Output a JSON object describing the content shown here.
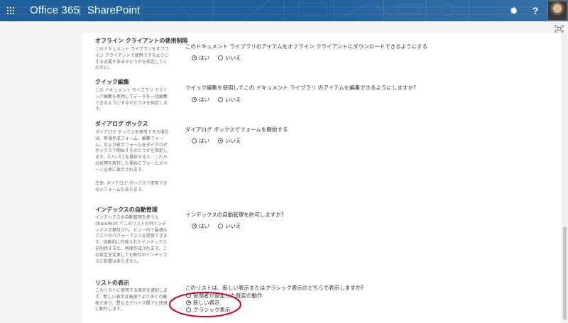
{
  "suite": {
    "brand": "Office 365",
    "app": "SharePoint",
    "icons": {
      "waffle": "app-launcher-icon",
      "settings": "gear-icon",
      "help": "help-icon",
      "avatar": "user-avatar"
    },
    "help_glyph": "?",
    "colors": {
      "suite_bar": "#1e5f9c",
      "panel": "#ffffff",
      "background": "#f4f4f4",
      "annotation": "#d0021b"
    }
  },
  "sections": [
    {
      "title": "オフライン クライアントの使用制限",
      "description": "このドキュメント ライブラリをオフライン クライアントで使用できるようにする必要があるかどうかを指定してください。",
      "question": "このドキュメント ライブラリのアイテムをオフライン クライアントにダウンロードできるようにする",
      "options": [
        {
          "label": "はい",
          "selected": true
        },
        {
          "label": "いいえ",
          "selected": false
        }
      ]
    },
    {
      "title": "クイック編集",
      "description": "この ドキュメント ライブラリ でクイック編集を使用してデータを一括編集できるようにするかどうかを指定します。",
      "question": "クイック編集を使用してこの ドキュメント ライブラリ のアイテムを編集できるようにしますか?",
      "options": [
        {
          "label": "はい",
          "selected": true
        },
        {
          "label": "いいえ",
          "selected": false
        }
      ]
    },
    {
      "title": "ダイアログ ボックス",
      "description": "ダイアログ ボックスを使用できる場合は、新規作成フォーム、編集フォーム、および表示フォームをダイアログ ボックスで開始するかどうかを指定します。[いいえ] を選択すると、これらの処理を実行した場合にフォームがページ全体に表示されます。",
      "note": "注意: ダイアログ ボックスで使用できないフォームもあります。",
      "question": "ダイアログ ボックスでフォームを開始する",
      "options": [
        {
          "label": "はい",
          "selected": false
        },
        {
          "label": "いいえ",
          "selected": true
        }
      ]
    },
    {
      "title": "インデックスの自動管理",
      "description": "インデックスの自動管理を使うと SharePoint でこのリストの列インデックスが保持され、ビュー内で最適なクエリのパフォーマンスを提供できます。自動的に作成されたインデックスを削除すると、再度作成されます。この設定を変更しても既存のインデックスに影響はありません。",
      "question": "インデックスの自動管理を許可しますか?",
      "options": [
        {
          "label": "はい",
          "selected": true
        },
        {
          "label": "いいえ",
          "selected": false
        }
      ]
    },
    {
      "title": "リストの表示",
      "description": "このリストに使用する表示を選択します。新しい表示は高速でより多くの機能があり、異なるデバイス間でも快適に動作します。",
      "question": "このリストは、新しい表示またはクラシック表示のどちらで表示しますか?",
      "options": [
        {
          "label": "管理者が設定した既定の動作",
          "selected": false
        },
        {
          "label": "新しい表示",
          "selected": true
        },
        {
          "label": "クラシック表示",
          "selected": false
        }
      ]
    }
  ]
}
